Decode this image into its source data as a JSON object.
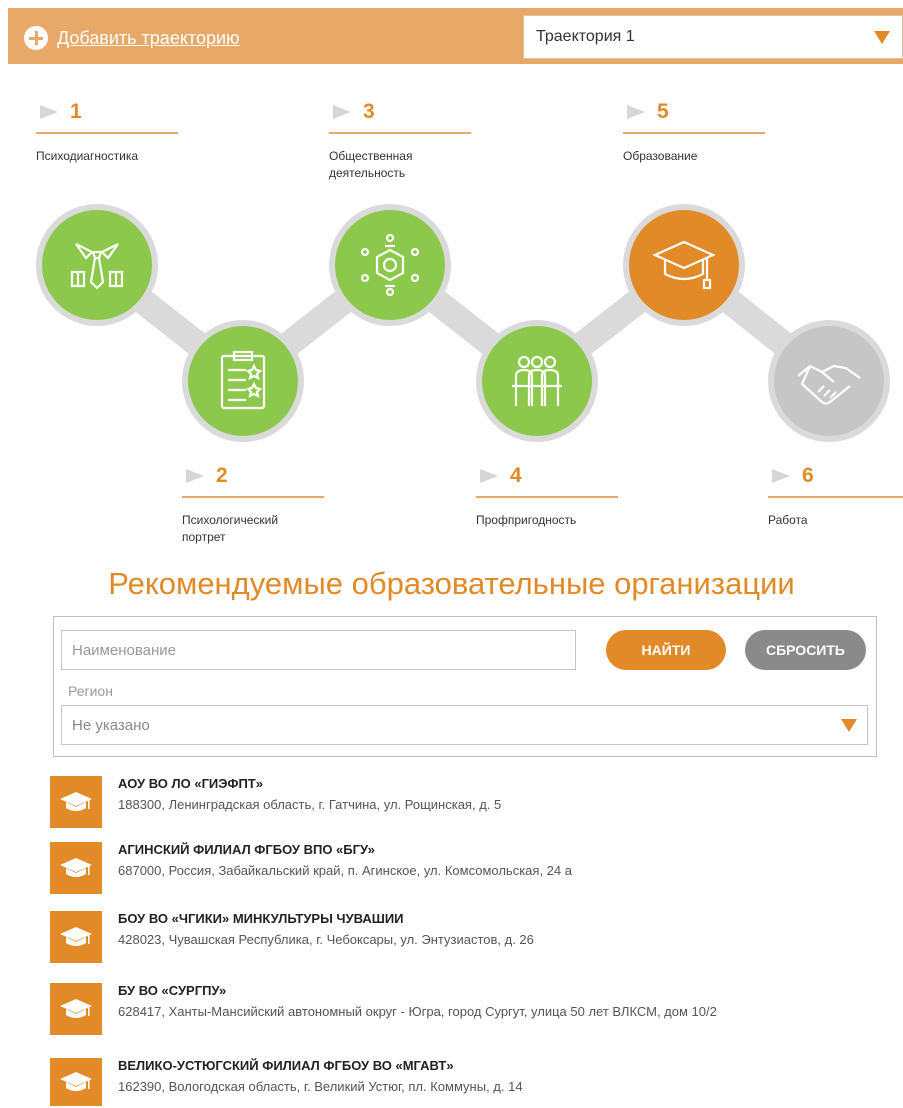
{
  "topbar": {
    "add_label": "Добавить траекторию",
    "trajectory_selected": "Траектория 1",
    "background_color": "#e8a868"
  },
  "steps": [
    {
      "number": "1",
      "label": "Психодиагностика",
      "icon": "tie-icon",
      "state": "done"
    },
    {
      "number": "2",
      "label": "Психологический портрет",
      "icon": "clipboard-icon",
      "state": "done"
    },
    {
      "number": "3",
      "label": "Общественная деятельность",
      "icon": "community-icon",
      "state": "done"
    },
    {
      "number": "4",
      "label": "Профпригодность",
      "icon": "team-icon",
      "state": "done"
    },
    {
      "number": "5",
      "label": "Образование",
      "icon": "graduation-cap-icon",
      "state": "active"
    },
    {
      "number": "6",
      "label": "Работа",
      "icon": "handshake-icon",
      "state": "pending"
    }
  ],
  "colors": {
    "done": "#8cc84b",
    "active": "#e28a27",
    "pending": "#c6c6c6",
    "accent": "#e28a27"
  },
  "section": {
    "title": "Рекомендуемые образовательные организации"
  },
  "filter": {
    "name_placeholder": "Наименование",
    "find_label": "НАЙТИ",
    "reset_label": "СБРОСИТЬ",
    "region_label": "Регион",
    "region_value": "Не указано"
  },
  "organizations": [
    {
      "name": "АОУ ВО ЛО «ГИЭФПТ»",
      "address": "188300, Ленинградская область, г. Гатчина, ул. Рощинская, д. 5"
    },
    {
      "name": "АГИНСКИЙ ФИЛИАЛ ФГБОУ ВПО «БГУ»",
      "address": "687000, Россия, Забайкальский край, п. Агинское, ул. Комсомольская, 24 а"
    },
    {
      "name": "БОУ ВО «ЧГИКИ» МИНКУЛЬТУРЫ ЧУВАШИИ",
      "address": "428023, Чувашская Республика, г. Чебоксары, ул. Энтузиастов, д. 26"
    },
    {
      "name": "БУ ВО «СУРГПУ»",
      "address": "628417, Ханты-Мансийский автономный округ - Югра, город Сургут, улица 50 лет ВЛКСМ, дом 10/2"
    },
    {
      "name": "ВЕЛИКО-УСТЮГСКИЙ ФИЛИАЛ ФГБОУ ВО «МГАВТ»",
      "address": "162390, Вологодская область, г. Великий Устюг, пл. Коммуны, д. 14"
    }
  ]
}
